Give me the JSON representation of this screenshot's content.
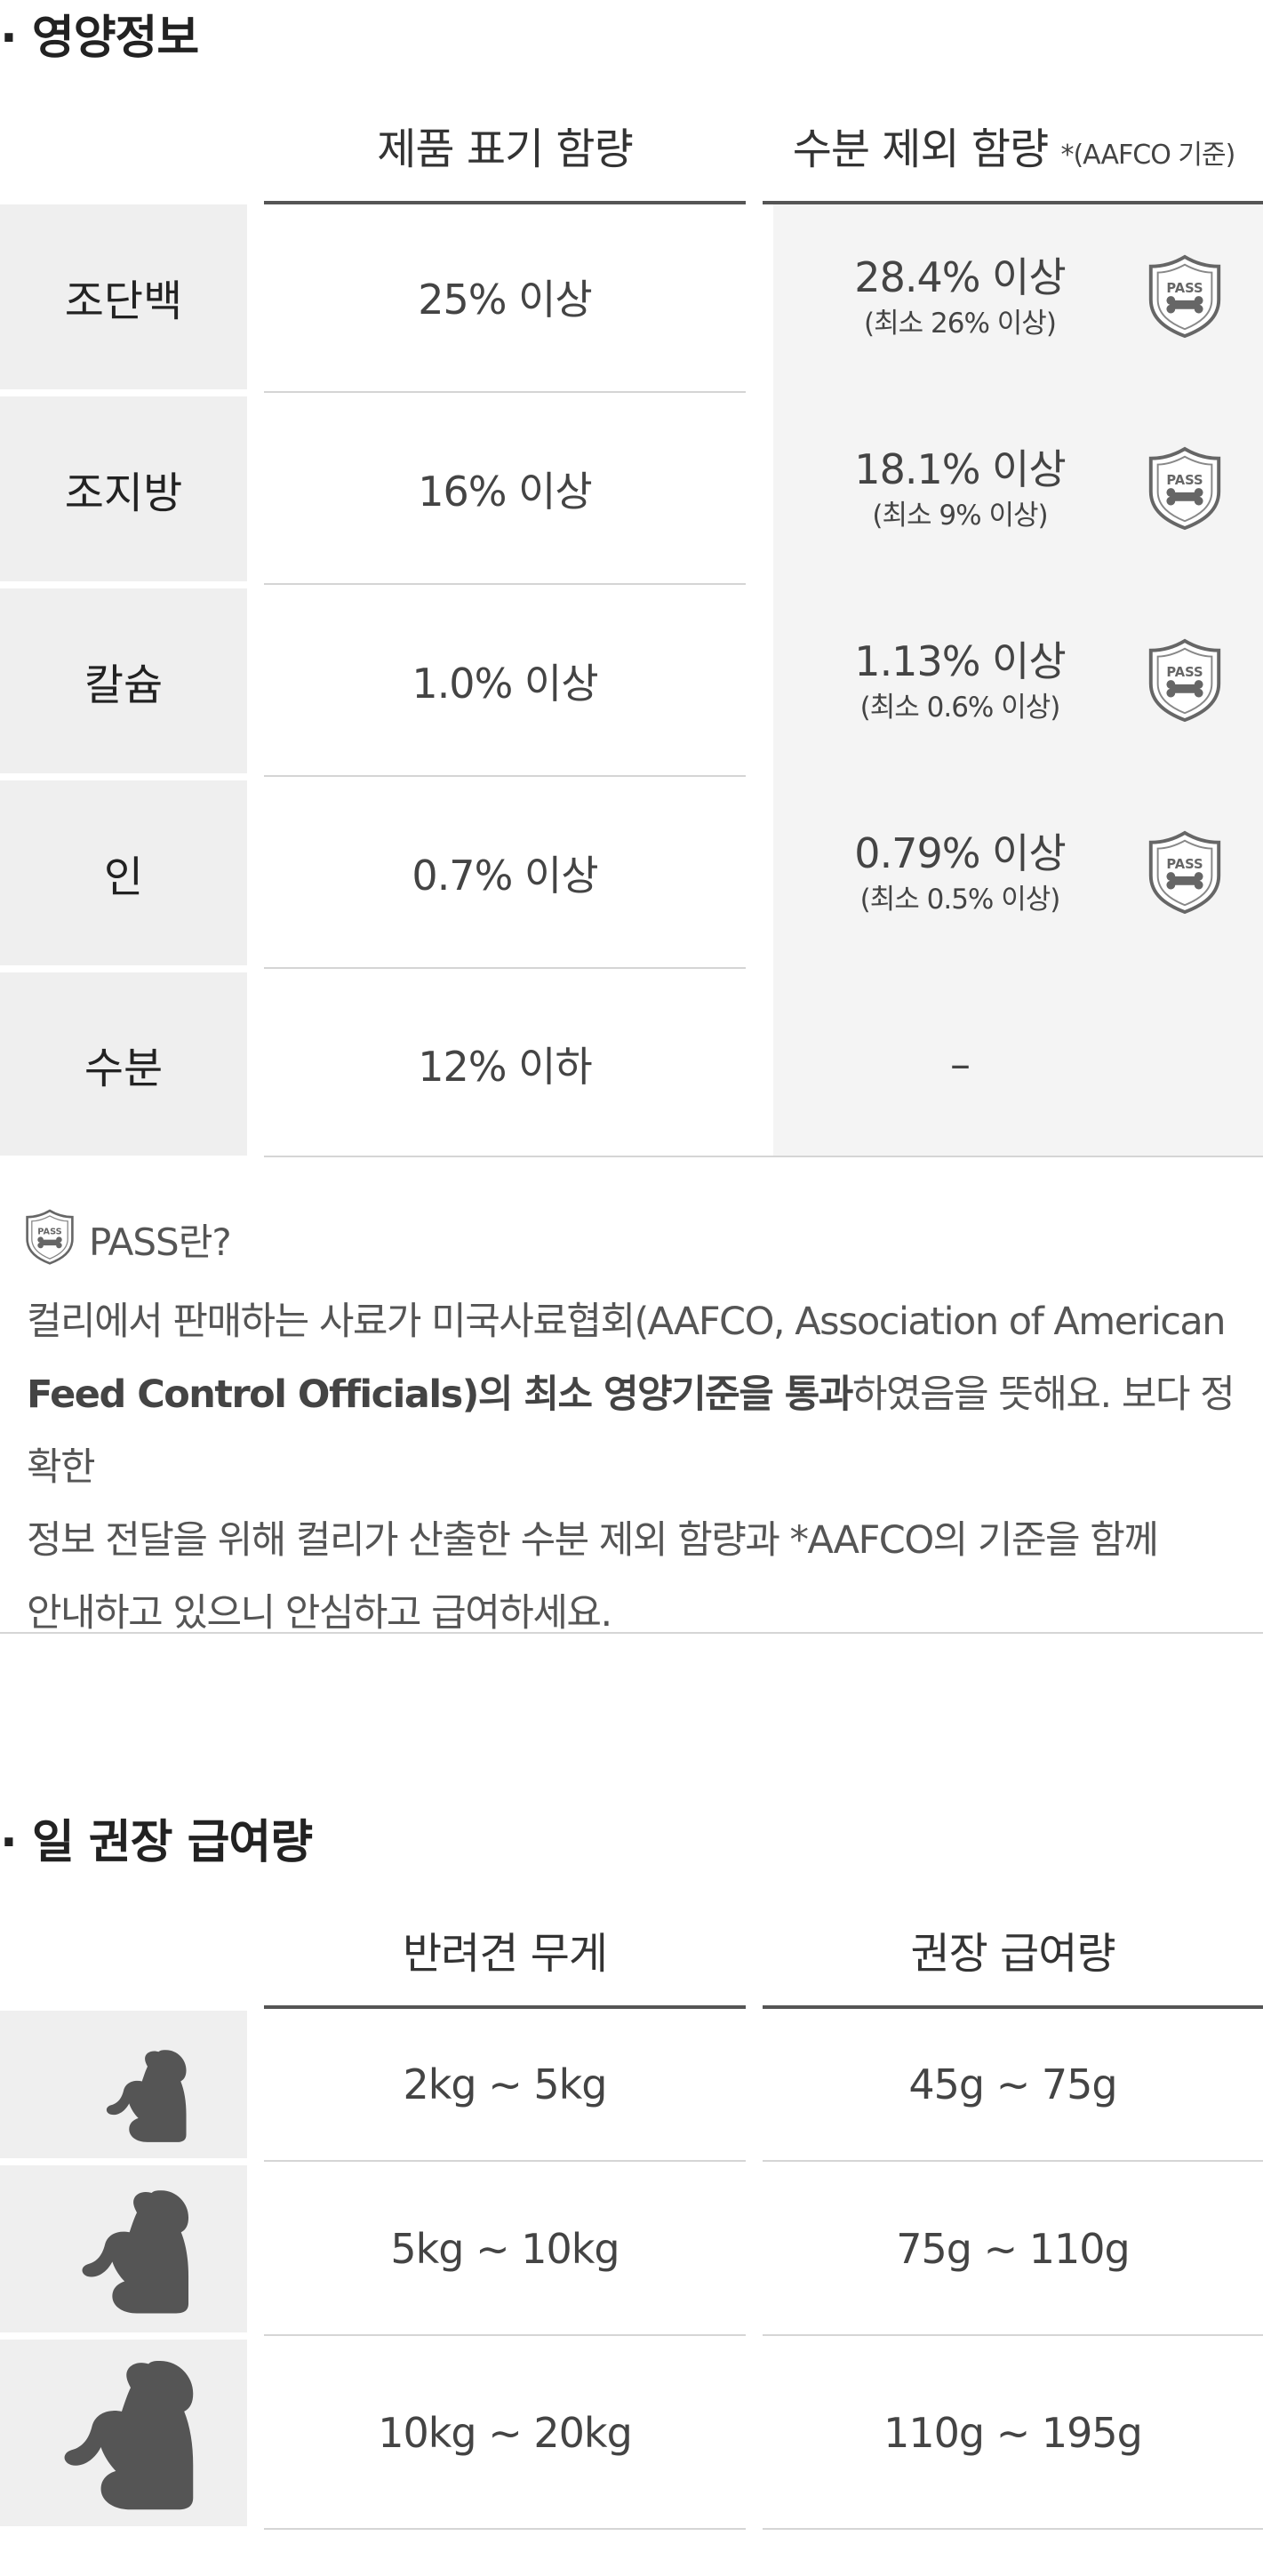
{
  "nutrition": {
    "title": "· 영양정보",
    "col_label": "제품 표기 함량",
    "col_dry": "수분 제외 함량",
    "col_dry_note": "*(AAFCO 기준)",
    "rows": [
      {
        "name": "조단백",
        "label_value": "25% 이상",
        "dry_value": "28.4% 이상",
        "dry_min": "(최소 26% 이상)",
        "pass": true
      },
      {
        "name": "조지방",
        "label_value": "16% 이상",
        "dry_value": "18.1% 이상",
        "dry_min": "(최소 9% 이상)",
        "pass": true
      },
      {
        "name": "칼슘",
        "label_value": "1.0% 이상",
        "dry_value": "1.13% 이상",
        "dry_min": "(최소 0.6% 이상)",
        "pass": true
      },
      {
        "name": "인",
        "label_value": "0.7% 이상",
        "dry_value": "0.79% 이상",
        "dry_min": "(최소 0.5% 이상)",
        "pass": true
      },
      {
        "name": "수분",
        "label_value": "12% 이하",
        "dry_value": "–",
        "dry_min": "",
        "pass": false
      }
    ],
    "badge_text": "PASS"
  },
  "pass_info": {
    "title": "PASS란?",
    "line1": "컬리에서 판매하는 사료가 미국사료협회(AAFCO, Association of American",
    "line2_a": "Feed Control Officials)의 최소 영양기준을 통과",
    "line2_b": "하였음을 뜻해요. 보다 정확한",
    "line3": "정보 전달을 위해 컬리가 산출한 수분 제외 함량과 *AAFCO의 기준을 함께",
    "line4": "안내하고 있으니 안심하고 급여하세요."
  },
  "feeding": {
    "title": "· 일 권장 급여량",
    "col_weight": "반려견 무게",
    "col_amount": "권장 급여량",
    "rows": [
      {
        "size": "small",
        "weight": "2kg ~ 5kg",
        "amount": "45g ~ 75g"
      },
      {
        "size": "medium",
        "weight": "5kg ~ 10kg",
        "amount": "75g ~ 110g"
      },
      {
        "size": "large",
        "weight": "10kg ~ 20kg",
        "amount": "110g ~ 195g"
      }
    ]
  },
  "colors": {
    "label_bg": "#efefef",
    "dry_bg": "#f4f4f4",
    "icon": "#555555",
    "rule": "#555555"
  }
}
